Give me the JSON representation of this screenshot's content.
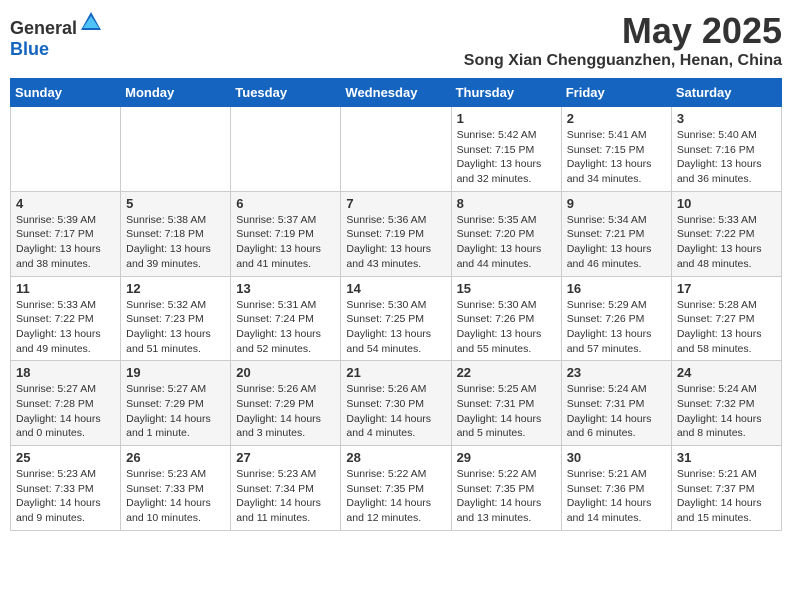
{
  "header": {
    "logo_general": "General",
    "logo_blue": "Blue",
    "month_title": "May 2025",
    "location": "Song Xian Chengguanzhen, Henan, China"
  },
  "columns": [
    "Sunday",
    "Monday",
    "Tuesday",
    "Wednesday",
    "Thursday",
    "Friday",
    "Saturday"
  ],
  "weeks": [
    [
      {
        "day": "",
        "info": ""
      },
      {
        "day": "",
        "info": ""
      },
      {
        "day": "",
        "info": ""
      },
      {
        "day": "",
        "info": ""
      },
      {
        "day": "1",
        "info": "Sunrise: 5:42 AM\nSunset: 7:15 PM\nDaylight: 13 hours\nand 32 minutes."
      },
      {
        "day": "2",
        "info": "Sunrise: 5:41 AM\nSunset: 7:15 PM\nDaylight: 13 hours\nand 34 minutes."
      },
      {
        "day": "3",
        "info": "Sunrise: 5:40 AM\nSunset: 7:16 PM\nDaylight: 13 hours\nand 36 minutes."
      }
    ],
    [
      {
        "day": "4",
        "info": "Sunrise: 5:39 AM\nSunset: 7:17 PM\nDaylight: 13 hours\nand 38 minutes."
      },
      {
        "day": "5",
        "info": "Sunrise: 5:38 AM\nSunset: 7:18 PM\nDaylight: 13 hours\nand 39 minutes."
      },
      {
        "day": "6",
        "info": "Sunrise: 5:37 AM\nSunset: 7:19 PM\nDaylight: 13 hours\nand 41 minutes."
      },
      {
        "day": "7",
        "info": "Sunrise: 5:36 AM\nSunset: 7:19 PM\nDaylight: 13 hours\nand 43 minutes."
      },
      {
        "day": "8",
        "info": "Sunrise: 5:35 AM\nSunset: 7:20 PM\nDaylight: 13 hours\nand 44 minutes."
      },
      {
        "day": "9",
        "info": "Sunrise: 5:34 AM\nSunset: 7:21 PM\nDaylight: 13 hours\nand 46 minutes."
      },
      {
        "day": "10",
        "info": "Sunrise: 5:33 AM\nSunset: 7:22 PM\nDaylight: 13 hours\nand 48 minutes."
      }
    ],
    [
      {
        "day": "11",
        "info": "Sunrise: 5:33 AM\nSunset: 7:22 PM\nDaylight: 13 hours\nand 49 minutes."
      },
      {
        "day": "12",
        "info": "Sunrise: 5:32 AM\nSunset: 7:23 PM\nDaylight: 13 hours\nand 51 minutes."
      },
      {
        "day": "13",
        "info": "Sunrise: 5:31 AM\nSunset: 7:24 PM\nDaylight: 13 hours\nand 52 minutes."
      },
      {
        "day": "14",
        "info": "Sunrise: 5:30 AM\nSunset: 7:25 PM\nDaylight: 13 hours\nand 54 minutes."
      },
      {
        "day": "15",
        "info": "Sunrise: 5:30 AM\nSunset: 7:26 PM\nDaylight: 13 hours\nand 55 minutes."
      },
      {
        "day": "16",
        "info": "Sunrise: 5:29 AM\nSunset: 7:26 PM\nDaylight: 13 hours\nand 57 minutes."
      },
      {
        "day": "17",
        "info": "Sunrise: 5:28 AM\nSunset: 7:27 PM\nDaylight: 13 hours\nand 58 minutes."
      }
    ],
    [
      {
        "day": "18",
        "info": "Sunrise: 5:27 AM\nSunset: 7:28 PM\nDaylight: 14 hours\nand 0 minutes."
      },
      {
        "day": "19",
        "info": "Sunrise: 5:27 AM\nSunset: 7:29 PM\nDaylight: 14 hours\nand 1 minute."
      },
      {
        "day": "20",
        "info": "Sunrise: 5:26 AM\nSunset: 7:29 PM\nDaylight: 14 hours\nand 3 minutes."
      },
      {
        "day": "21",
        "info": "Sunrise: 5:26 AM\nSunset: 7:30 PM\nDaylight: 14 hours\nand 4 minutes."
      },
      {
        "day": "22",
        "info": "Sunrise: 5:25 AM\nSunset: 7:31 PM\nDaylight: 14 hours\nand 5 minutes."
      },
      {
        "day": "23",
        "info": "Sunrise: 5:24 AM\nSunset: 7:31 PM\nDaylight: 14 hours\nand 6 minutes."
      },
      {
        "day": "24",
        "info": "Sunrise: 5:24 AM\nSunset: 7:32 PM\nDaylight: 14 hours\nand 8 minutes."
      }
    ],
    [
      {
        "day": "25",
        "info": "Sunrise: 5:23 AM\nSunset: 7:33 PM\nDaylight: 14 hours\nand 9 minutes."
      },
      {
        "day": "26",
        "info": "Sunrise: 5:23 AM\nSunset: 7:33 PM\nDaylight: 14 hours\nand 10 minutes."
      },
      {
        "day": "27",
        "info": "Sunrise: 5:23 AM\nSunset: 7:34 PM\nDaylight: 14 hours\nand 11 minutes."
      },
      {
        "day": "28",
        "info": "Sunrise: 5:22 AM\nSunset: 7:35 PM\nDaylight: 14 hours\nand 12 minutes."
      },
      {
        "day": "29",
        "info": "Sunrise: 5:22 AM\nSunset: 7:35 PM\nDaylight: 14 hours\nand 13 minutes."
      },
      {
        "day": "30",
        "info": "Sunrise: 5:21 AM\nSunset: 7:36 PM\nDaylight: 14 hours\nand 14 minutes."
      },
      {
        "day": "31",
        "info": "Sunrise: 5:21 AM\nSunset: 7:37 PM\nDaylight: 14 hours\nand 15 minutes."
      }
    ]
  ]
}
